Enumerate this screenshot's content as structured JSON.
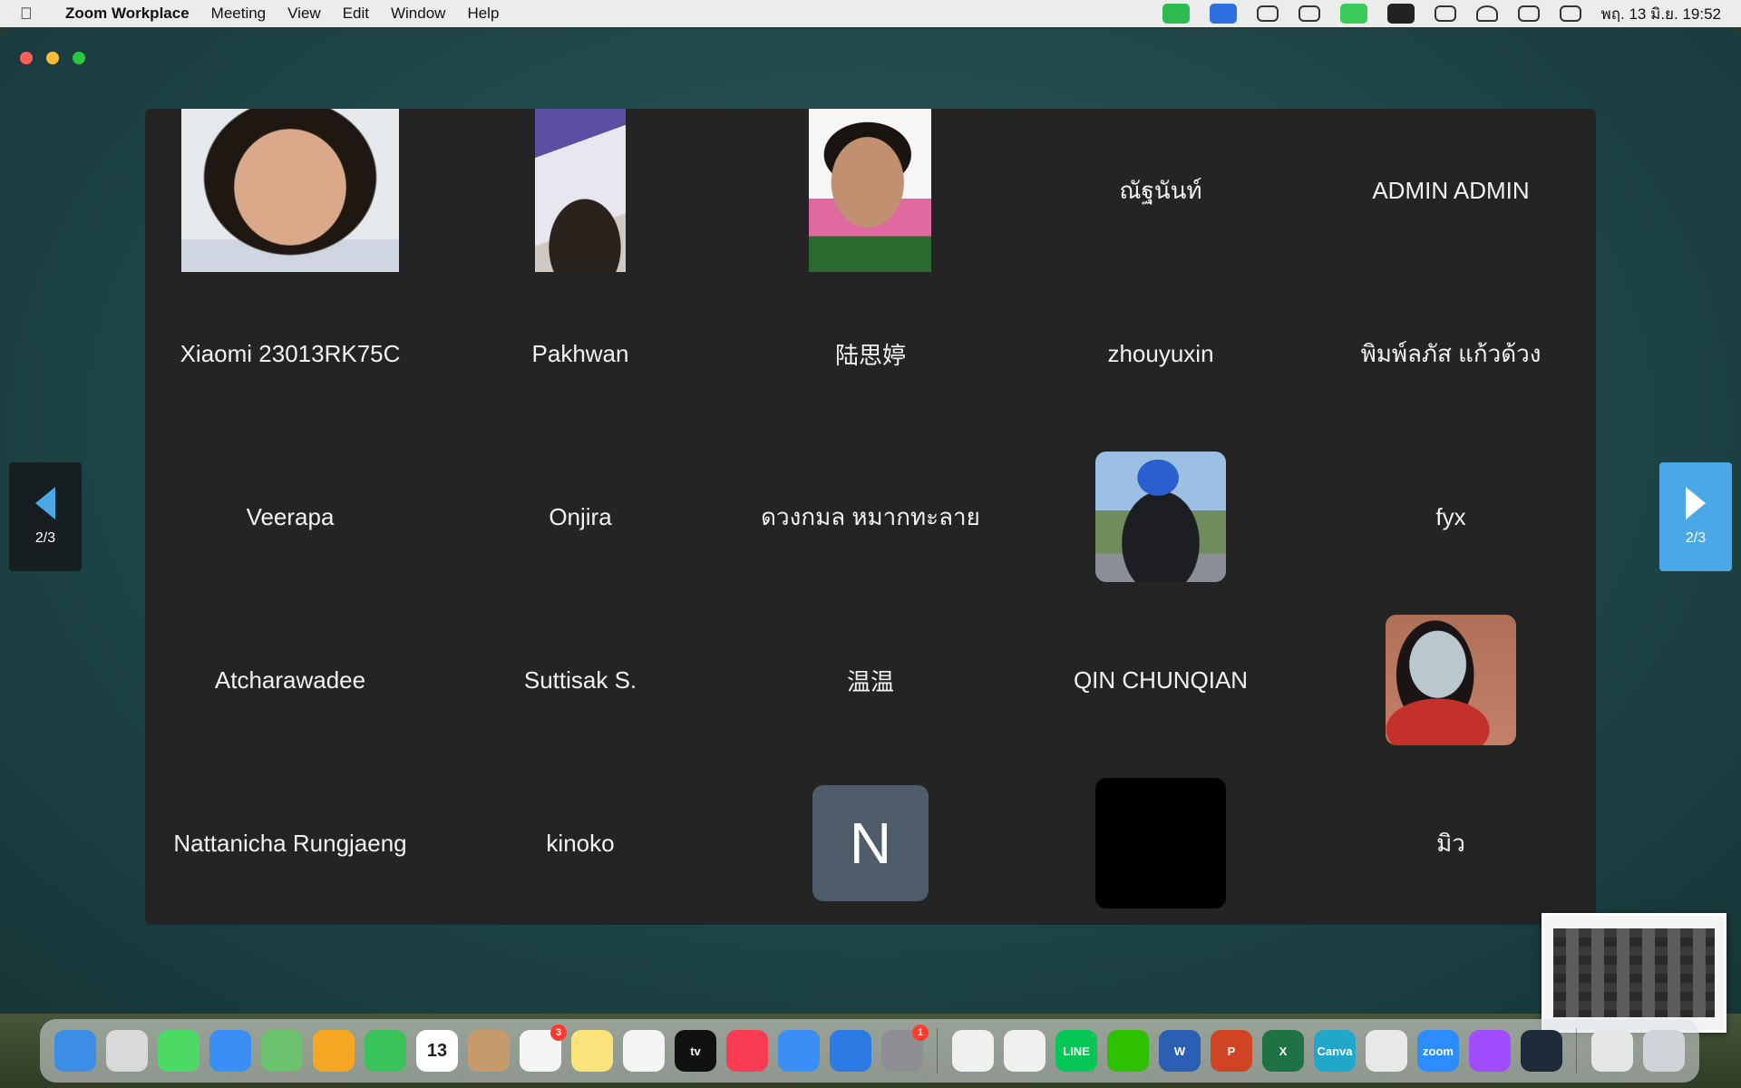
{
  "menubar": {
    "app_name": "Zoom Workplace",
    "items": [
      "Meeting",
      "View",
      "Edit",
      "Window",
      "Help"
    ],
    "clock": "พฤ. 13 มิ.ย. 19:52",
    "status_icons": [
      {
        "name": "zoom-video-icon",
        "color": "#2dbb4f"
      },
      {
        "name": "zoom-zm-icon",
        "color": "#2d6fe0"
      },
      {
        "name": "chat-bubble-icon",
        "color": "#333333"
      },
      {
        "name": "wechat-icon",
        "color": "#333333"
      },
      {
        "name": "line-icon",
        "color": "#3acb5a"
      },
      {
        "name": "n-app-icon",
        "color": "#222222"
      },
      {
        "name": "battery-icon",
        "color": "#333333"
      },
      {
        "name": "wifi-icon",
        "color": "#333333"
      },
      {
        "name": "spotlight-search-icon",
        "color": "#333333"
      },
      {
        "name": "control-center-icon",
        "color": "#333333"
      }
    ]
  },
  "gallery": {
    "participants": [
      {
        "name": "",
        "kind": "video",
        "photo": "woman-smiling"
      },
      {
        "name": "",
        "kind": "video",
        "photo": "boy-ceiling"
      },
      {
        "name": "",
        "kind": "video",
        "photo": "boy-pink-wall"
      },
      {
        "name": "ณัฐนันท์",
        "kind": "name"
      },
      {
        "name": "ADMIN ADMIN",
        "kind": "name"
      },
      {
        "name": "Xiaomi 23013RK75C",
        "kind": "name"
      },
      {
        "name": "Pakhwan",
        "kind": "name"
      },
      {
        "name": "陆思婷",
        "kind": "name"
      },
      {
        "name": "zhouyuxin",
        "kind": "name"
      },
      {
        "name": "พิมพ์ลภัส แก้วด้วง",
        "kind": "name"
      },
      {
        "name": "Veerapa",
        "kind": "name"
      },
      {
        "name": "Onjira",
        "kind": "name"
      },
      {
        "name": "ดวงกมล หมากทะลาย",
        "kind": "name"
      },
      {
        "name": "",
        "kind": "avatar-photo",
        "photo": "man-outdoor"
      },
      {
        "name": "fyx",
        "kind": "name"
      },
      {
        "name": "Atcharawadee",
        "kind": "name"
      },
      {
        "name": "Suttisak S.",
        "kind": "name"
      },
      {
        "name": "温温",
        "kind": "name"
      },
      {
        "name": "QIN CHUNQIAN",
        "kind": "name"
      },
      {
        "name": "",
        "kind": "avatar-photo",
        "photo": "woman-brick-wall"
      },
      {
        "name": "Nattanicha Rungjaeng",
        "kind": "name"
      },
      {
        "name": "kinoko",
        "kind": "name"
      },
      {
        "name": "N",
        "kind": "avatar-letter"
      },
      {
        "name": "",
        "kind": "avatar-black"
      },
      {
        "name": "มิว",
        "kind": "name"
      }
    ]
  },
  "pagination": {
    "prev_label": "2/3",
    "next_label": "2/3",
    "prev_color": "#161e22",
    "next_color": "#4aa8e6"
  },
  "dock": {
    "apps": [
      {
        "name": "finder-icon",
        "color": "#3b8de6"
      },
      {
        "name": "launchpad-icon",
        "color": "#d9d9d9"
      },
      {
        "name": "messages-icon",
        "color": "#4cd964"
      },
      {
        "name": "mail-icon",
        "color": "#3a8ef5"
      },
      {
        "name": "maps-icon",
        "color": "#6cc16c"
      },
      {
        "name": "photos-icon",
        "color": "#f5a623"
      },
      {
        "name": "facetime-icon",
        "color": "#3ac35a"
      },
      {
        "name": "calendar-icon",
        "color": "#ffffff",
        "text": "13"
      },
      {
        "name": "contacts-icon",
        "color": "#c79a6b"
      },
      {
        "name": "reminders-icon",
        "color": "#f4f4f4",
        "badge": "3"
      },
      {
        "name": "notes-icon",
        "color": "#fbe27a"
      },
      {
        "name": "freeform-icon",
        "color": "#f4f4f4"
      },
      {
        "name": "apple-tv-icon",
        "color": "#111111",
        "text": "tv"
      },
      {
        "name": "music-icon",
        "color": "#fa3c52"
      },
      {
        "name": "safari-icon",
        "color": "#3a8ef5"
      },
      {
        "name": "app-store-icon",
        "color": "#2c7be5"
      },
      {
        "name": "system-settings-icon",
        "color": "#8e8e93",
        "badge": "1"
      },
      {
        "name": "chrome-icon",
        "color": "#f0f0f0"
      },
      {
        "name": "chat-icon",
        "color": "#f0f0f0"
      },
      {
        "name": "line-app-icon",
        "color": "#06c755",
        "text": "LINE"
      },
      {
        "name": "wechat-app-icon",
        "color": "#2dc100"
      },
      {
        "name": "word-icon",
        "color": "#2b5fb4",
        "text": "W"
      },
      {
        "name": "powerpoint-icon",
        "color": "#d04423",
        "text": "P"
      },
      {
        "name": "excel-icon",
        "color": "#1f7244",
        "text": "X"
      },
      {
        "name": "canva-icon",
        "color": "#20a7c9",
        "text": "Canva"
      },
      {
        "name": "preview-icon",
        "color": "#e8e8e8"
      },
      {
        "name": "zoom-app-icon",
        "color": "#2d8cff",
        "text": "zoom"
      },
      {
        "name": "messenger-icon",
        "color": "#a04dff"
      },
      {
        "name": "quicktime-icon",
        "color": "#1c2a3a"
      },
      {
        "name": "downloads-stack-icon",
        "color": "#e6e6e6"
      },
      {
        "name": "trash-icon",
        "color": "#d0d4d8"
      }
    ]
  }
}
